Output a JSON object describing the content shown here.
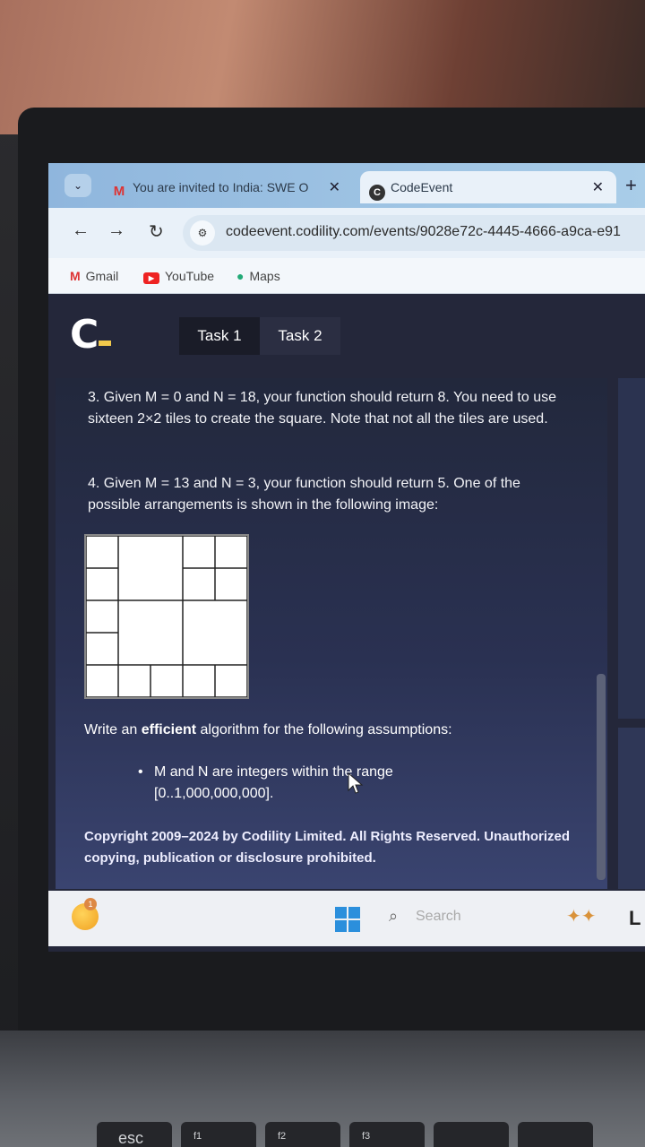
{
  "browser": {
    "tabs": [
      {
        "label": "You are invited to India: SWE O",
        "close": "✕"
      },
      {
        "label": "CodeEvent",
        "close": "✕"
      }
    ],
    "new_tab": "+",
    "url": "codeevent.codility.com/events/9028e72c-4445-4666-a9ca-e91",
    "bookmarks": [
      {
        "label": "Gmail"
      },
      {
        "label": "YouTube"
      },
      {
        "label": "Maps"
      }
    ]
  },
  "app": {
    "logo": "C",
    "tasks": [
      {
        "label": "Task 1",
        "active": true
      },
      {
        "label": "Task 2",
        "active": false
      }
    ]
  },
  "problem": {
    "example3": "3. Given M = 0 and N = 18, your function should return 8. You need to use sixteen 2×2 tiles to create the square. Note that not all the tiles are used.",
    "example4": "4. Given M = 13 and N = 3, your function should return 5. One of the possible arrangements is shown in the following image:",
    "heading_prefix": "Write an ",
    "heading_bold": "efficient",
    "heading_suffix": " algorithm for the following assumptions:",
    "assumption": "M and N are integers within the range [0..1,000,000,000].",
    "copyright": "Copyright 2009–2024 by Codility Limited. All Rights Reserved. Unauthorized copying, publication or disclosure prohibited."
  },
  "taskbar": {
    "notification_count": "1",
    "search_placeholder": "Search"
  },
  "keyboard": {
    "esc": "esc",
    "f1": "f1",
    "f2": "f2",
    "f3": "f3"
  }
}
